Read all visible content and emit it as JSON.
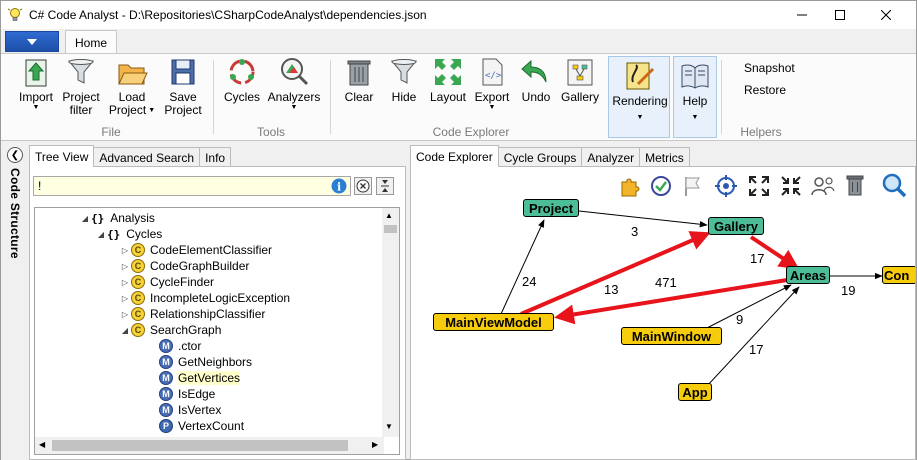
{
  "window": {
    "title": "C# Code Analyst - D:\\Repositories\\CSharpCodeAnalyst\\dependencies.json"
  },
  "ribbon": {
    "tab_home": "Home",
    "file": {
      "label": "File",
      "import": "Import",
      "project_filter_1": "Project",
      "project_filter_2": "filter",
      "load_project_1": "Load",
      "load_project_2": "Project",
      "save_project_1": "Save",
      "save_project_2": "Project"
    },
    "tools": {
      "label": "Tools",
      "cycles": "Cycles",
      "analyzers": "Analyzers"
    },
    "explorer": {
      "label": "Code Explorer",
      "clear": "Clear",
      "hide": "Hide",
      "layout": "Layout",
      "export": "Export",
      "undo": "Undo",
      "gallery": "Gallery",
      "rendering": "Rendering",
      "help": "Help"
    },
    "helpers": {
      "label": "Helpers",
      "snapshot": "Snapshot",
      "restore": "Restore"
    }
  },
  "side": {
    "title": "Code Structure"
  },
  "left_tabs": [
    "Tree View",
    "Advanced Search",
    "Info"
  ],
  "search": {
    "value": "!"
  },
  "tree": [
    {
      "indent": 0,
      "expander": "◢",
      "kind": "ns",
      "label": "Analysis"
    },
    {
      "indent": 1,
      "expander": "◢",
      "kind": "ns",
      "label": "Cycles"
    },
    {
      "indent": 2,
      "expander": "▷",
      "kind": "C",
      "label": "CodeElementClassifier"
    },
    {
      "indent": 2,
      "expander": "▷",
      "kind": "C",
      "label": "CodeGraphBuilder"
    },
    {
      "indent": 2,
      "expander": "▷",
      "kind": "C",
      "label": "CycleFinder"
    },
    {
      "indent": 2,
      "expander": "▷",
      "kind": "C",
      "label": "IncompleteLogicException"
    },
    {
      "indent": 2,
      "expander": "▷",
      "kind": "C",
      "label": "RelationshipClassifier"
    },
    {
      "indent": 2,
      "expander": "◢",
      "kind": "C",
      "label": "SearchGraph"
    },
    {
      "indent": 3,
      "expander": "",
      "kind": "M",
      "label": ".ctor"
    },
    {
      "indent": 3,
      "expander": "",
      "kind": "M",
      "label": "GetNeighbors"
    },
    {
      "indent": 3,
      "expander": "",
      "kind": "M",
      "label": "GetVertices",
      "highlight": true
    },
    {
      "indent": 3,
      "expander": "",
      "kind": "M",
      "label": "IsEdge"
    },
    {
      "indent": 3,
      "expander": "",
      "kind": "M",
      "label": "IsVertex"
    },
    {
      "indent": 3,
      "expander": "",
      "kind": "P",
      "label": "VertexCount"
    }
  ],
  "right_tabs": [
    "Code Explorer",
    "Cycle Groups",
    "Analyzer",
    "Metrics"
  ],
  "graph": {
    "nodes": {
      "project": "Project",
      "gallery": "Gallery",
      "areas": "Areas",
      "con": "Con",
      "mainviewmodel": "MainViewModel",
      "mainwindow": "MainWindow",
      "app": "App"
    },
    "edges": {
      "mvm_project": "24",
      "project_gallery": "3",
      "mvm_gallery": "13",
      "gallery_areas": "17",
      "areas_mvm": "471",
      "mainwindow_areas": "9",
      "app_areas": "17",
      "areas_con": "19"
    },
    "colors": {
      "node_green": "#4dbd98",
      "node_yellow": "#f6cc0c",
      "cycle_edge": "#e8141c"
    }
  }
}
